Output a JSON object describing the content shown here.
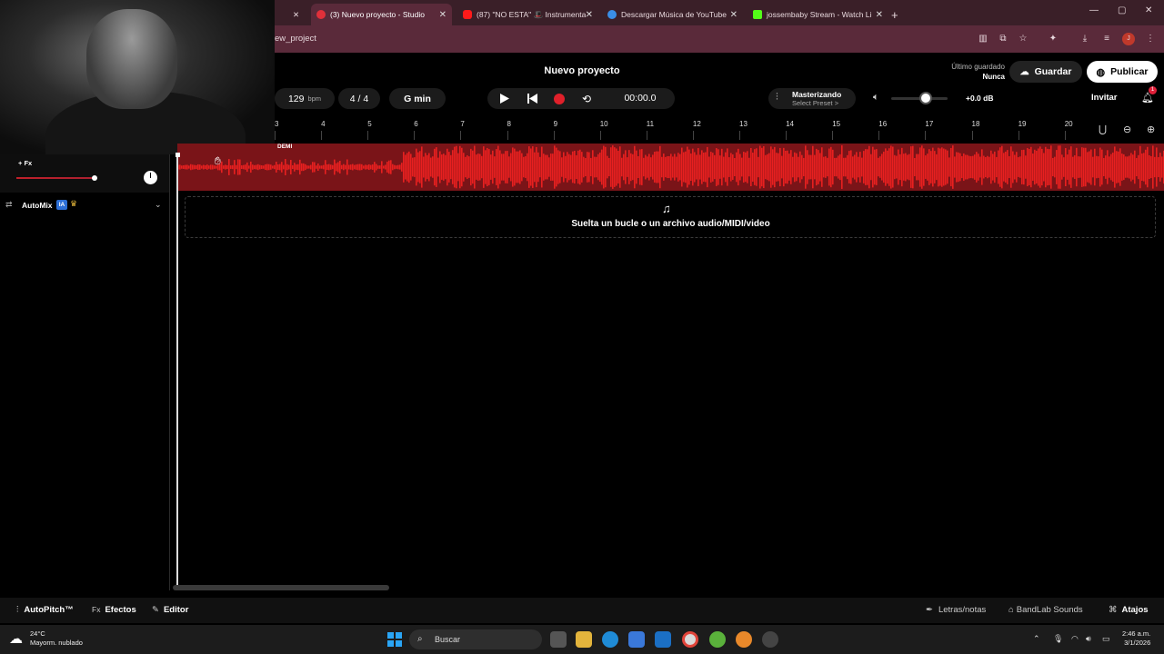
{
  "browser": {
    "tabs": [
      {
        "title": "(3) Nuevo proyecto - Studio",
        "active": true
      },
      {
        "title": "(87) \"NO ESTA\" 🎩 Instrumenta",
        "active": false
      },
      {
        "title": "Descargar Música de YouTube",
        "active": false
      },
      {
        "title": "jossembaby Stream - Watch Li",
        "active": false
      }
    ],
    "new_tab": "+",
    "address": "ew_project",
    "window_controls": {
      "minimize": "—",
      "maximize": "▢",
      "close": "✕"
    }
  },
  "app": {
    "project_title": "Nuevo proyecto",
    "last_saved_label": "Último guardado",
    "last_saved_value": "Nunca",
    "save_label": "Guardar",
    "publish_label": "Publicar",
    "tempo_value": "129",
    "tempo_unit": "bpm",
    "time_signature": "4 / 4",
    "key": "G min",
    "time": "00:00.0",
    "mastering_label": "Masterizando",
    "mastering_preset": "Select Preset >",
    "volume_db": "+0.0 dB",
    "volume_level": 0.62,
    "invite_label": "Invitar",
    "notification_count": "1"
  },
  "ruler": {
    "bars": [
      "3",
      "4",
      "5",
      "6",
      "7",
      "8",
      "9",
      "10",
      "11",
      "12",
      "13",
      "14",
      "15",
      "16",
      "17",
      "18",
      "19",
      "20"
    ]
  },
  "track": {
    "fx_label": "+ Fx",
    "clip_name": "DEMI",
    "automix_label": "AutoMix",
    "automix_badge": "IA"
  },
  "dropzone": {
    "text": "Suelta un bucle o un archivo audio/MIDI/video"
  },
  "bottom": {
    "autopitch": "AutoPitch™",
    "effects_prefix": "Fx",
    "effects": "Efectos",
    "editor": "Editor",
    "lyrics": "Letras/notas",
    "sounds": "BandLab Sounds",
    "shortcuts": "Atajos"
  },
  "taskbar": {
    "temperature": "24°C",
    "weather": "Mayorm. nublado",
    "search": "Buscar",
    "time": "2:46 a.m.",
    "date": "3/1/2026"
  },
  "colors": {
    "accent_red": "#e0202a",
    "browser_frame": "#5a2a3a",
    "waveform": "#e82020"
  }
}
